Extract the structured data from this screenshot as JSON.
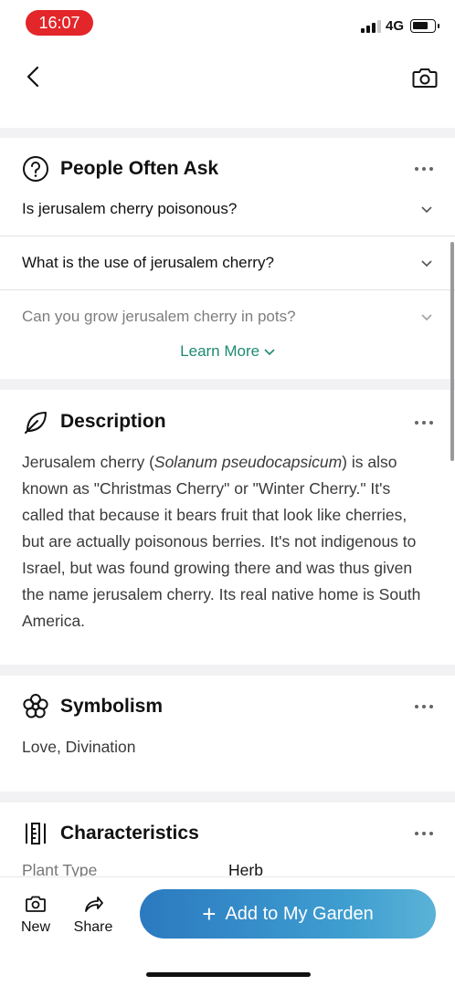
{
  "status_bar": {
    "time": "16:07",
    "network": "4G"
  },
  "people_often_ask": {
    "title": "People Often Ask",
    "questions": [
      "Is jerusalem cherry poisonous?",
      "What is the use of jerusalem cherry?",
      "Can you grow jerusalem cherry in pots?"
    ],
    "learn_more": "Learn More"
  },
  "description": {
    "title": "Description",
    "text_before": "Jerusalem cherry (",
    "text_italic": "Solanum pseudocapsicum",
    "text_after": ") is also known as \"Christmas Cherry\" or \"Winter Cherry.\" It's called that because it bears fruit that look like cherries, but are actually poisonous berries. It's not indigenous to Israel, but was found growing there and was thus given the name jerusalem cherry. Its real native home is South America."
  },
  "symbolism": {
    "title": "Symbolism",
    "text": "Love, Divination"
  },
  "characteristics": {
    "title": "Characteristics",
    "rows": [
      {
        "label": "Plant Type",
        "value": "Herb"
      }
    ]
  },
  "bottom_bar": {
    "new_label": "New",
    "share_label": "Share",
    "add_label": "Add to My Garden"
  },
  "colors": {
    "accent_green": "#1e8a72",
    "button_blue": "#2b79c0",
    "time_pill_red": "#e3262a"
  }
}
